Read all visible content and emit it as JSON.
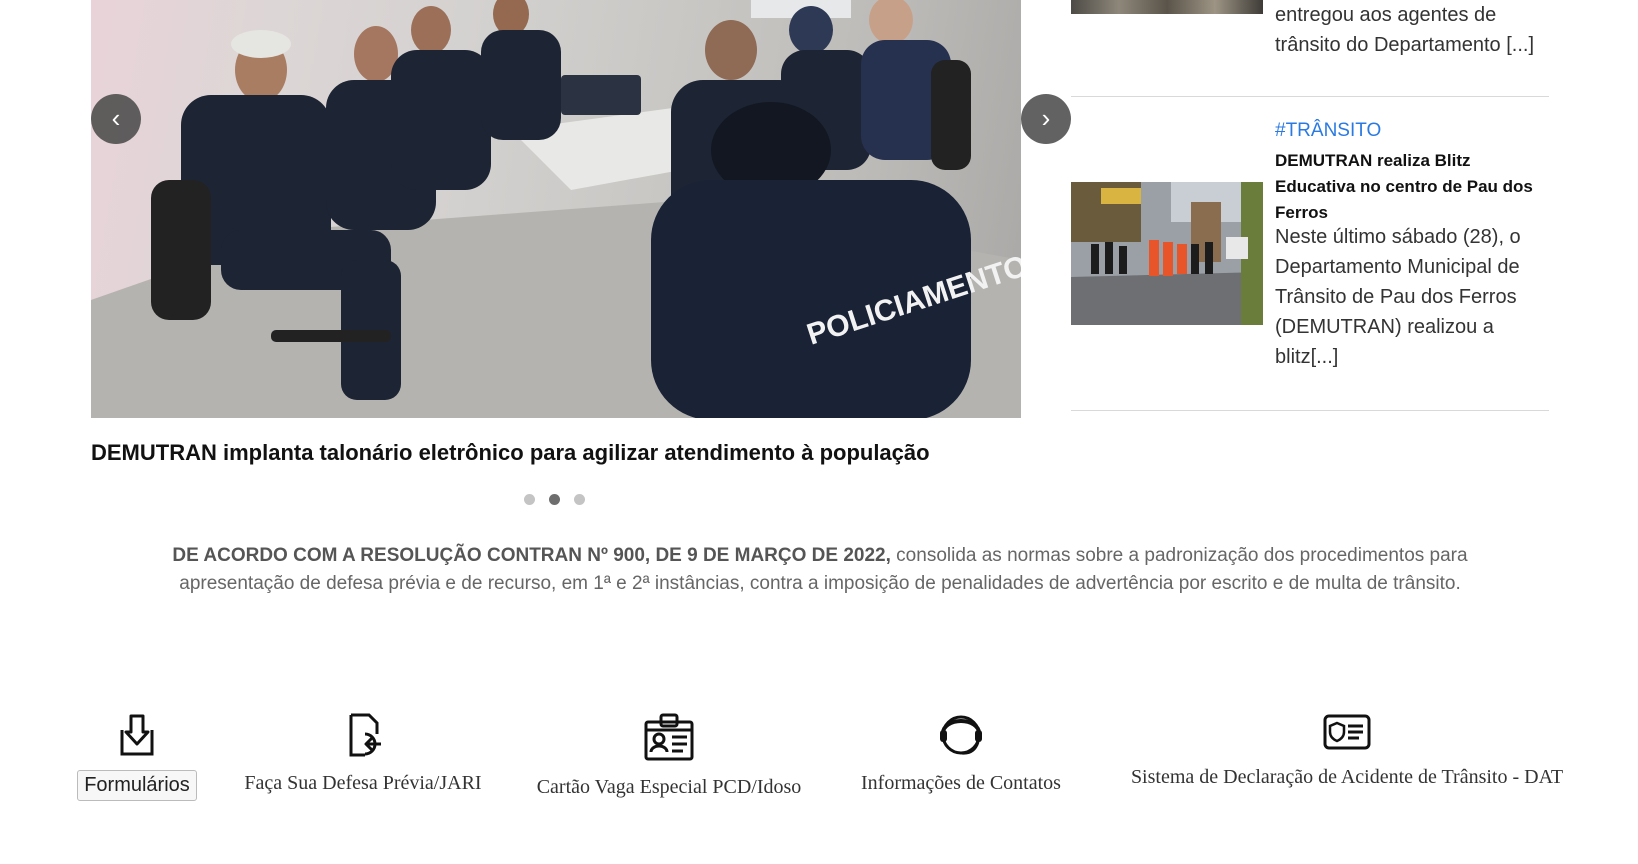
{
  "carousel": {
    "prev_label": "‹",
    "next_label": "›",
    "image_text": "POLICIAMENTO DE TRÂNSITO",
    "caption": "DEMUTRAN implanta talonário eletrônico para agilizar atendimento à população",
    "active_dot": 2,
    "dot_count": 3
  },
  "news": {
    "previous_excerpt": "entregou aos agentes de trânsito do Departamento [...]",
    "item": {
      "tag": "#TRÂNSITO",
      "title": "DEMUTRAN realiza Blitz Educativa no centro de Pau dos Ferros",
      "excerpt": "Neste último sábado (28), o Departamento Municipal de Trânsito de Pau dos Ferros (DEMUTRAN) realizou a blitz[...]"
    }
  },
  "notice": {
    "bold": "DE ACORDO COM A RESOLUÇÃO CONTRAN Nº 900, DE 9 DE MARÇO DE 2022,",
    "text": " consolida as normas sobre a padronização dos procedimentos para apresentação de defesa prévia e de recurso, em 1ª e 2ª instâncias, contra a imposição de penalidades de advertência por escrito e de multa de trânsito."
  },
  "services": [
    {
      "label": "Formulários",
      "icon": "download-icon"
    },
    {
      "label": "Faça Sua Defesa Prévia/JARI",
      "icon": "document-return-icon"
    },
    {
      "label": "Cartão Vaga Especial PCD/Idoso",
      "icon": "id-card-clip-icon"
    },
    {
      "label": "Informações de Contatos",
      "icon": "headset-icon"
    },
    {
      "label": "Sistema de Declaração de Acidente de Trânsito - DAT",
      "icon": "shield-card-icon"
    }
  ],
  "colors": {
    "tag": "#2a7ae2",
    "carousel_button": "#464646",
    "dot_active": "#6e6e6e",
    "dot_inactive": "#c4c4c4"
  }
}
